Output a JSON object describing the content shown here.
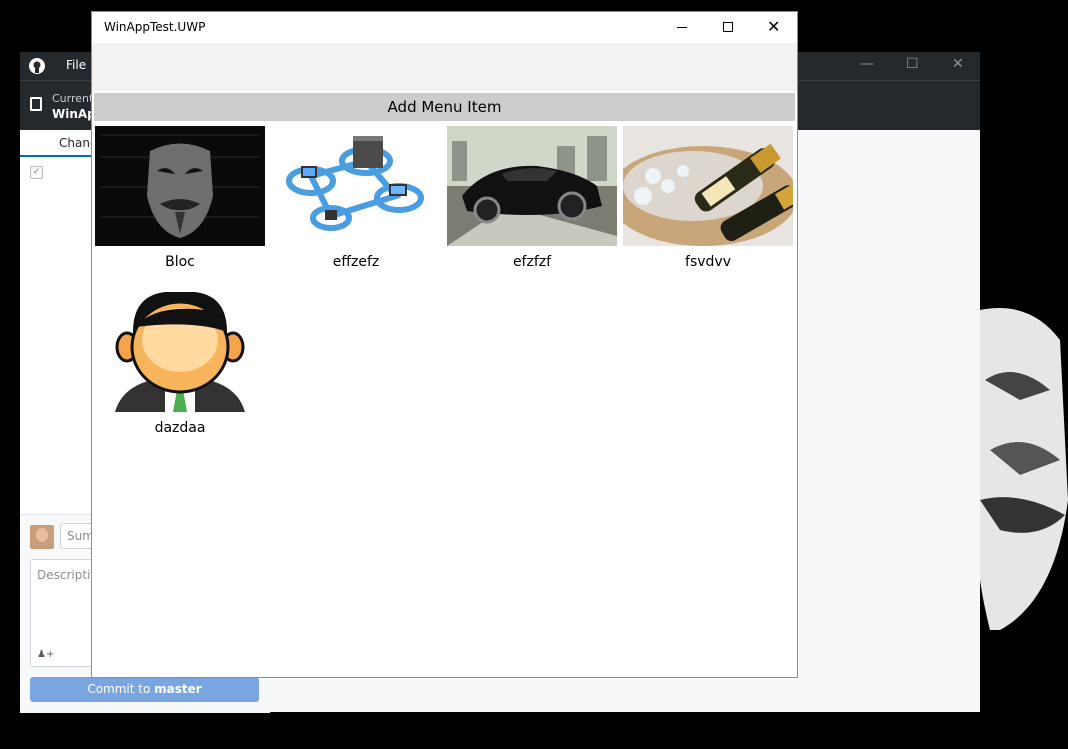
{
  "github": {
    "menu_file": "File",
    "toolbar_current": "Current",
    "toolbar_repo": "WinApp",
    "tab_changes": "Chang",
    "summary_placeholder": "Sum",
    "description_placeholder": "Descriptio",
    "commit_prefix": "Commit to ",
    "commit_branch": "master",
    "controls": {
      "minimize": "—",
      "maximize": "☐",
      "close": "✕"
    }
  },
  "uwp": {
    "title": "WinAppTest.UWP",
    "add_menu_item": "Add Menu Item",
    "controls": {
      "close": "✕"
    },
    "items": [
      {
        "label": "Bloc",
        "image": "anonymous-mask"
      },
      {
        "label": "effzefz",
        "image": "network-diagram"
      },
      {
        "label": "efzfzf",
        "image": "sports-car"
      },
      {
        "label": "fsvdvv",
        "image": "champagne-bucket"
      },
      {
        "label": "dazdaa",
        "image": "businessman-avatar"
      }
    ]
  },
  "colors": {
    "github_dark": "#24292e",
    "commit_button": "#79a6e0",
    "uwp_border": "#5b9bd5",
    "add_button": "#cccccc"
  }
}
